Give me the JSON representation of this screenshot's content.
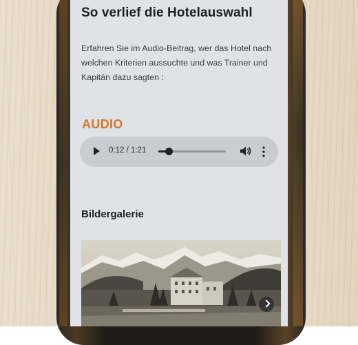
{
  "article": {
    "title": "So verlief die Hotelauswahl",
    "intro": "Erfahren Sie im Audio-Beitrag, wer das Hotel nach welchen Kriterien aussuchte und was Trainer und Kapitän dazu sagten :"
  },
  "audio": {
    "heading": "AUDIO",
    "time_display": "0:12 / 1:21",
    "progress_fraction": 0.148
  },
  "gallery": {
    "heading": "Bildergalerie"
  },
  "icons": {
    "play": "play-icon",
    "volume": "volume-icon",
    "more": "more-vertical-icon",
    "next": "chevron-right-icon"
  },
  "colors": {
    "accent": "#d9742c",
    "screen_bg": "#dfe3e7",
    "player_bg": "#c9cdd2"
  }
}
